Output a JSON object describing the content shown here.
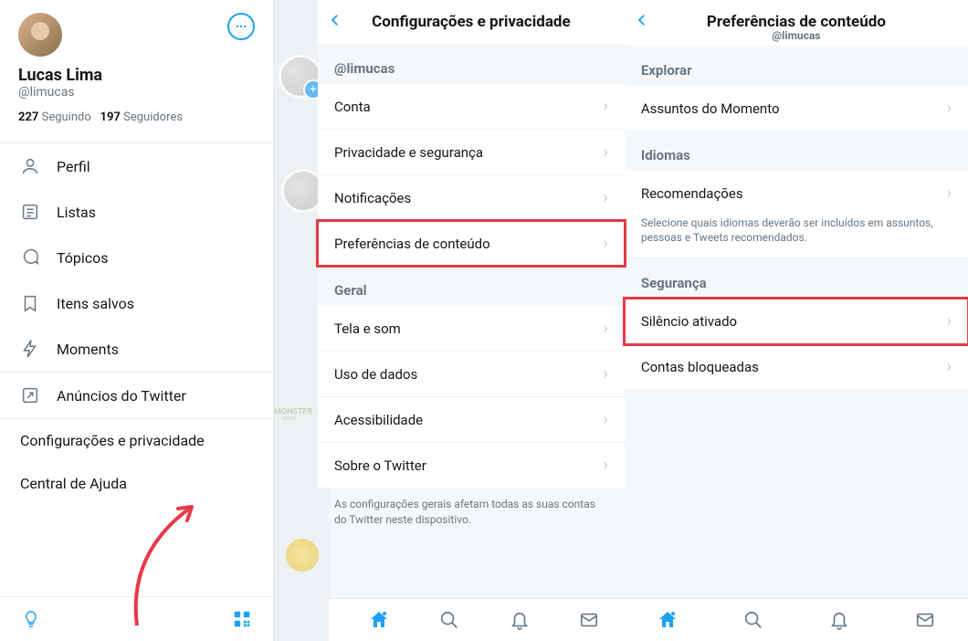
{
  "drawer": {
    "name": "Lucas Lima",
    "handle": "@limucas",
    "following_count": "227",
    "following_label": "Seguindo",
    "followers_count": "197",
    "followers_label": "Seguidores",
    "items": [
      {
        "label": "Perfil"
      },
      {
        "label": "Listas"
      },
      {
        "label": "Tópicos"
      },
      {
        "label": "Itens salvos"
      },
      {
        "label": "Moments"
      }
    ],
    "ads_label": "Anúncios do Twitter",
    "settings_label": "Configurações e privacidade",
    "help_label": "Central de Ajuda"
  },
  "middle": {
    "title": "Configurações e privacidade",
    "section_user": "@limucas",
    "rows_user": [
      {
        "label": "Conta"
      },
      {
        "label": "Privacidade e segurança"
      },
      {
        "label": "Notificações"
      },
      {
        "label": "Preferências de conteúdo"
      }
    ],
    "section_general": "Geral",
    "rows_general": [
      {
        "label": "Tela e som"
      },
      {
        "label": "Uso de dados"
      },
      {
        "label": "Acessibilidade"
      },
      {
        "label": "Sobre o Twitter"
      }
    ],
    "footnote": "As configurações gerais afetam todas as suas contas do Twitter neste dispositivo."
  },
  "right": {
    "title": "Preferências de conteúdo",
    "sub_handle": "@limucas",
    "section_explore": "Explorar",
    "rows_explore": [
      {
        "label": "Assuntos do Momento"
      }
    ],
    "section_lang": "Idiomas",
    "rows_lang": [
      {
        "label": "Recomendações"
      }
    ],
    "lang_note": "Selecione quais idiomas deverão ser incluídos em assuntos, pessoas e Tweets recomendados.",
    "section_sec": "Segurança",
    "rows_sec": [
      {
        "label": "Silêncio ativado"
      },
      {
        "label": "Contas bloqueadas"
      }
    ]
  }
}
